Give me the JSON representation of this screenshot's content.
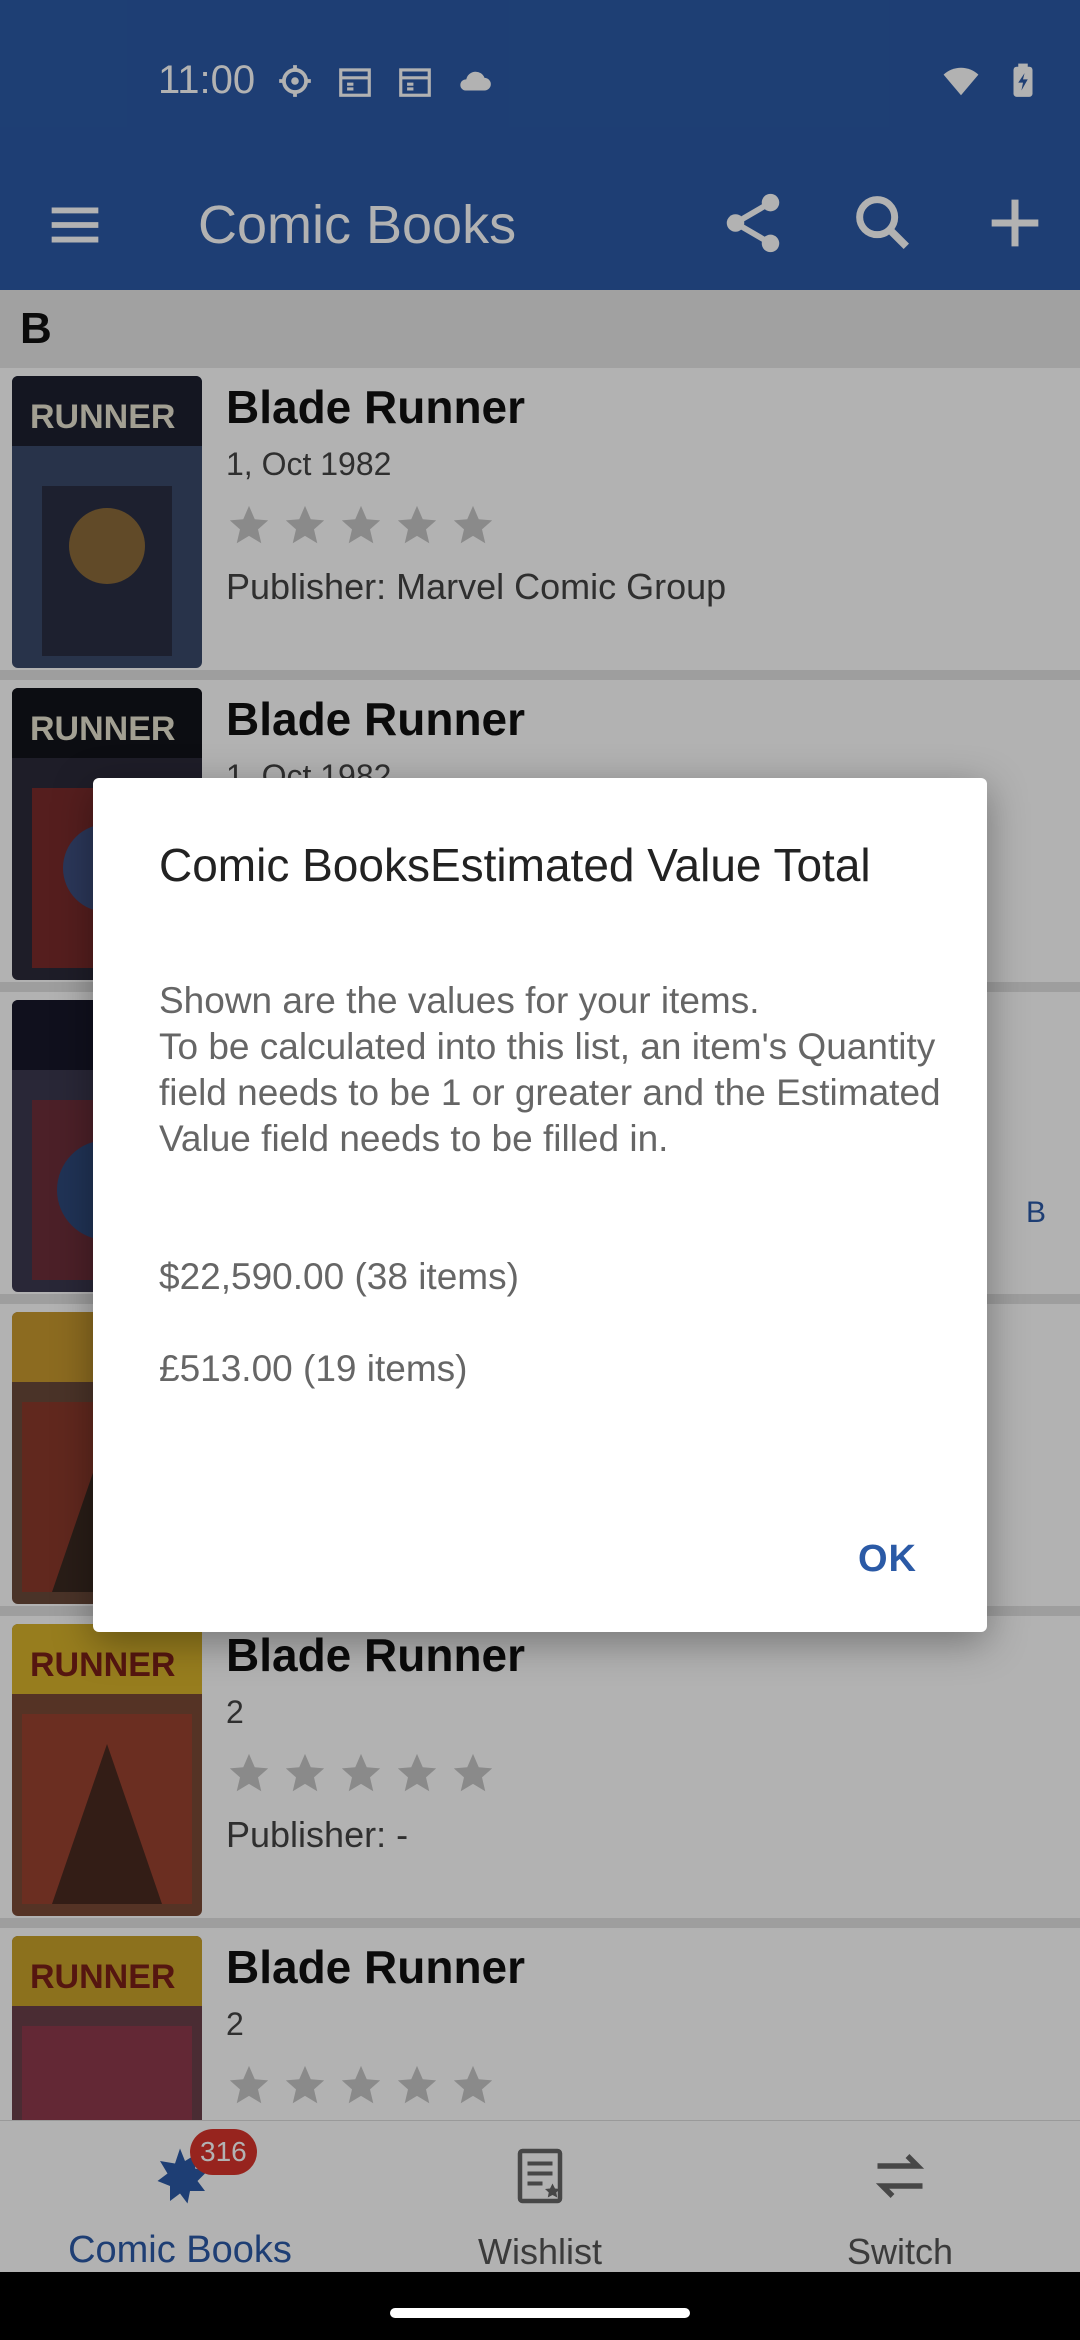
{
  "status_bar": {
    "time": "11:00"
  },
  "app_bar": {
    "title": "Comic Books"
  },
  "list": {
    "section": "B",
    "side_index_letter": "B",
    "items": [
      {
        "title": "Blade Runner",
        "subtitle": "1, Oct 1982",
        "publisher": "Publisher: Marvel Comic Group"
      },
      {
        "title": "Blade Runner",
        "subtitle": "1, Oct 1982",
        "publisher": ""
      },
      {
        "title": "",
        "subtitle": "",
        "publisher": ""
      },
      {
        "title": "",
        "subtitle": "",
        "publisher": ""
      },
      {
        "title": "Blade Runner",
        "subtitle": "2",
        "publisher": "Publisher: -"
      },
      {
        "title": "Blade Runner",
        "subtitle": "2",
        "publisher": ""
      }
    ],
    "rating": 0
  },
  "dialog": {
    "title": "Comic BooksEstimated Value Total",
    "message": "Shown are the values for your items.\nTo be calculated into this list, an item's Quantity field needs to be 1 or greater and the Estimated Value field needs to be filled in.",
    "value_usd": "$22,590.00 (38 items)",
    "value_gbp": "£513.00 (19 items)",
    "ok_label": "OK"
  },
  "bottom_nav": {
    "items": [
      {
        "label": "Comic Books",
        "badge": "316",
        "active": true
      },
      {
        "label": "Wishlist"
      },
      {
        "label": "Switch"
      }
    ]
  },
  "colors": {
    "primary": "#2b5aa6",
    "badge": "#d9342b"
  }
}
